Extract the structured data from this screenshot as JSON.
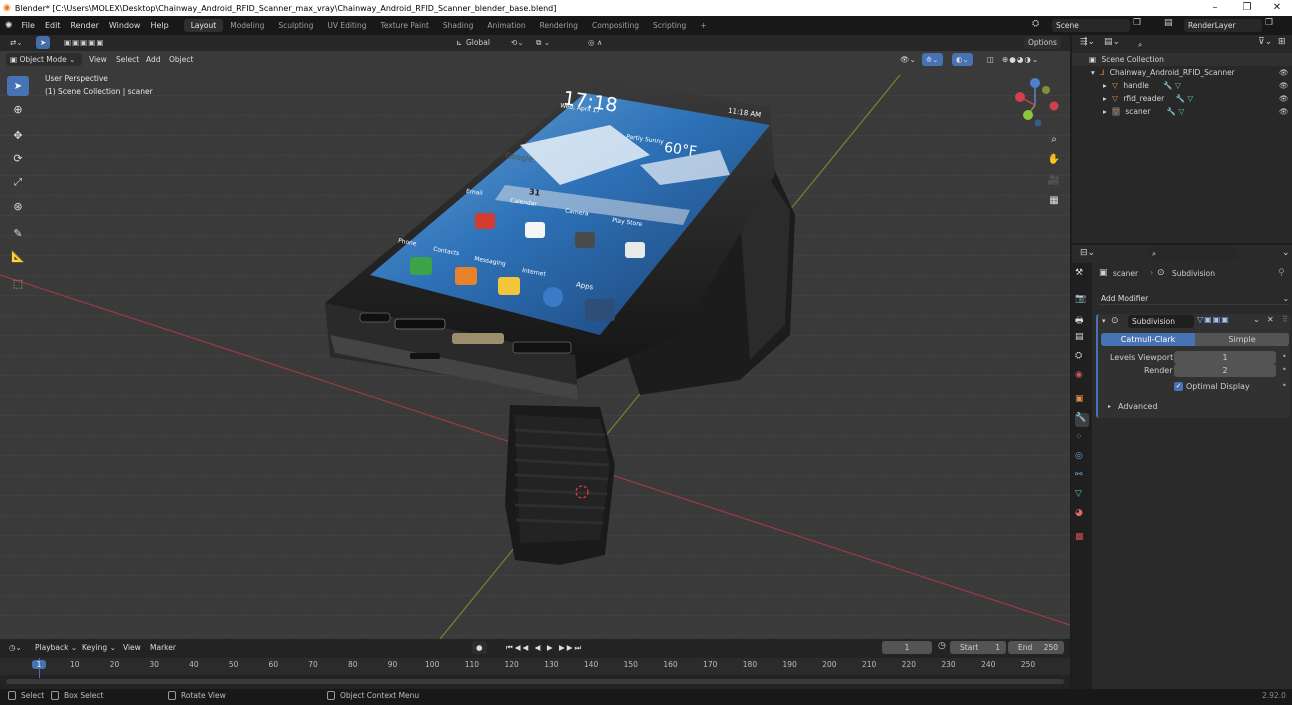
{
  "window": {
    "title": "Blender* [C:\\Users\\MOLEX\\Desktop\\Chainway_Android_RFID_Scanner_max_vray\\Chainway_Android_RFID_Scanner_blender_base.blend]",
    "minimize": "–",
    "restore": "❐",
    "close": "✕"
  },
  "menubar": {
    "menus": [
      "File",
      "Edit",
      "Render",
      "Window",
      "Help"
    ],
    "workspaces": [
      "Layout",
      "Modeling",
      "Sculpting",
      "UV Editing",
      "Texture Paint",
      "Shading",
      "Animation",
      "Rendering",
      "Compositing",
      "Scripting"
    ],
    "active_workspace": "Layout",
    "add_workspace": "+",
    "scene": "Scene",
    "view_layer": "RenderLayer"
  },
  "viewport": {
    "transform_orientation": "Global",
    "options": "Options",
    "mode": "Object Mode",
    "menus": [
      "View",
      "Select",
      "Add",
      "Object"
    ],
    "overlay_line1": "User Perspective",
    "overlay_line2": "(1) Scene Collection | scaner",
    "phone": {
      "time": "17:18",
      "status_time": "11:18 AM",
      "date": "Wed, April 17",
      "weather": "Partly Sunny",
      "temp": "60°F",
      "search": "Google",
      "apps_row1": [
        "Email",
        "Calendar",
        "Camera",
        "Play Store"
      ],
      "apps_row2": [
        "Phone",
        "Contacts",
        "Messaging",
        "Internet",
        "Apps"
      ],
      "calendar_day": "31"
    }
  },
  "outliner": {
    "root": "Scene Collection",
    "collection": "Chainway_Android_RFID_Scanner",
    "objects": [
      "handle",
      "rfid_reader",
      "scaner"
    ]
  },
  "properties": {
    "object_name": "scaner",
    "modifier_context": "Subdivision",
    "add_modifier": "Add Modifier",
    "modifier_name": "Subdivision",
    "tab_catmull": "Catmull-Clark",
    "tab_simple": "Simple",
    "levels_viewport_label": "Levels Viewport",
    "levels_viewport": "1",
    "render_label": "Render",
    "render_value": "2",
    "optimal_display": "Optimal Display",
    "advanced": "Advanced"
  },
  "timeline": {
    "menus": [
      "Playback",
      "Keying",
      "View",
      "Marker"
    ],
    "current_frame": "1",
    "start_label": "Start",
    "start": "1",
    "end_label": "End",
    "end": "250",
    "ticks": [
      "1",
      "10",
      "20",
      "30",
      "40",
      "50",
      "60",
      "70",
      "80",
      "90",
      "100",
      "110",
      "120",
      "130",
      "140",
      "150",
      "160",
      "170",
      "180",
      "190",
      "200",
      "210",
      "220",
      "230",
      "240",
      "250"
    ]
  },
  "statusbar": {
    "select": "Select",
    "box_select": "Box Select",
    "rotate_view": "Rotate View",
    "context_menu": "Object Context Menu",
    "version": "2.92.0"
  }
}
